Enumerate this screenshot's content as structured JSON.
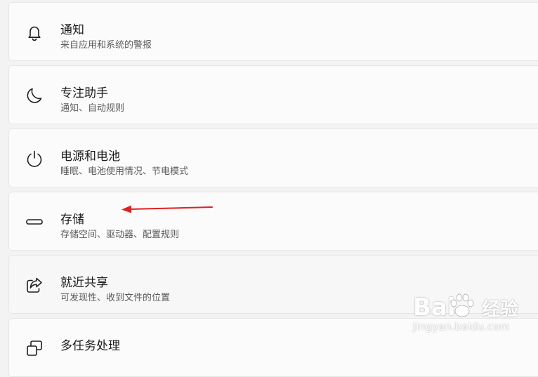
{
  "settings": {
    "items": [
      {
        "icon": "bell-icon",
        "title": "通知",
        "subtitle": "来自应用和系统的警报"
      },
      {
        "icon": "moon-icon",
        "title": "专注助手",
        "subtitle": "通知、自动规则"
      },
      {
        "icon": "power-icon",
        "title": "电源和电池",
        "subtitle": "睡眠、电池使用情况、节电模式"
      },
      {
        "icon": "storage-drive-icon",
        "title": "存储",
        "subtitle": "存储空间、驱动器、配置规则"
      },
      {
        "icon": "share-icon",
        "title": "就近共享",
        "subtitle": "可发现性、收到文件的位置"
      },
      {
        "icon": "multitasking-icon",
        "title": "多任务处理",
        "subtitle": ""
      }
    ]
  },
  "annotation": {
    "arrow_color": "#e02020"
  },
  "watermark": {
    "logo": "Bai",
    "brand": "经验",
    "url": "jingyan.baidu.com"
  }
}
